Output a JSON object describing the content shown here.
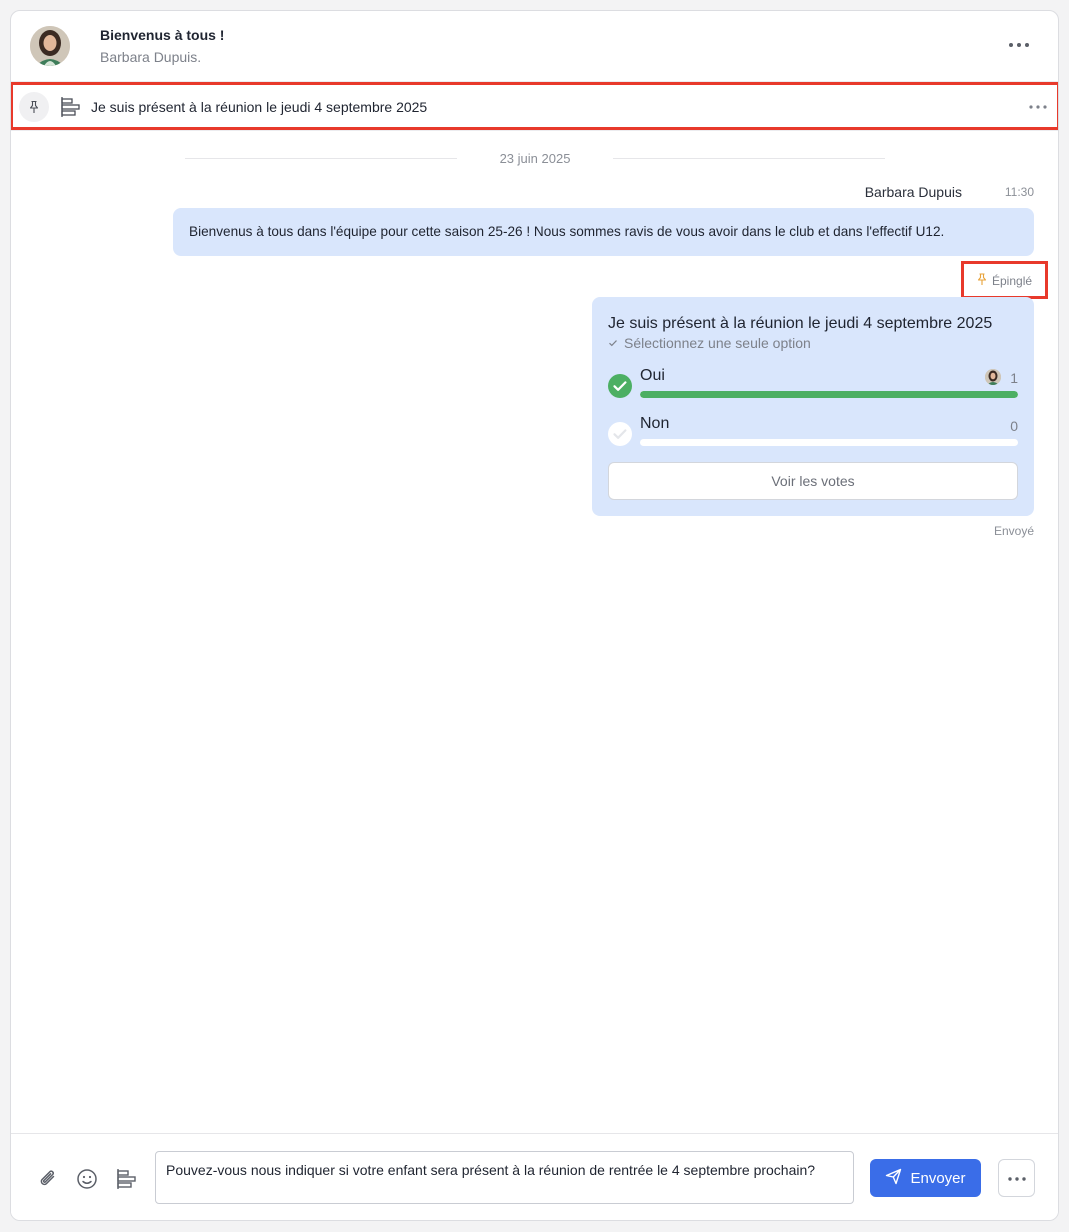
{
  "header": {
    "title": "Bienvenus à tous !",
    "subtitle": "Barbara Dupuis."
  },
  "pinned_bar": {
    "text": "Je suis présent à la réunion le jeudi 4 septembre 2025"
  },
  "date_separator": "23 juin 2025",
  "message": {
    "sender": "Barbara Dupuis",
    "time": "11:30",
    "text": "Bienvenus à tous dans l'équipe pour cette saison 25-26 ! Nous sommes ravis de vous avoir dans le club et dans l'effectif U12."
  },
  "pinned_tag": "Épinglé",
  "poll": {
    "question": "Je suis présent à la réunion le jeudi 4 septembre 2025",
    "subtitle": "Sélectionnez une seule option",
    "options": [
      {
        "label": "Oui",
        "count": "1",
        "fraction": 1.0,
        "selected": true
      },
      {
        "label": "Non",
        "count": "0",
        "fraction": 0.0,
        "selected": false
      }
    ],
    "votes_button": "Voir les votes"
  },
  "status": "Envoyé",
  "composer": {
    "value": "Pouvez-vous nous indiquer si votre enfant sera présent à la réunion de rentrée le 4 septembre prochain?",
    "send_label": "Envoyer"
  },
  "colors": {
    "accent": "#3a6de8",
    "bubble": "#d9e6fc",
    "success": "#4caf63",
    "highlight": "#e8392b",
    "pin": "#e8a33a"
  },
  "icons": [
    "pin-icon",
    "poll-icon",
    "more-icon",
    "paperclip-icon",
    "emoji-icon",
    "send-icon",
    "check-icon"
  ]
}
